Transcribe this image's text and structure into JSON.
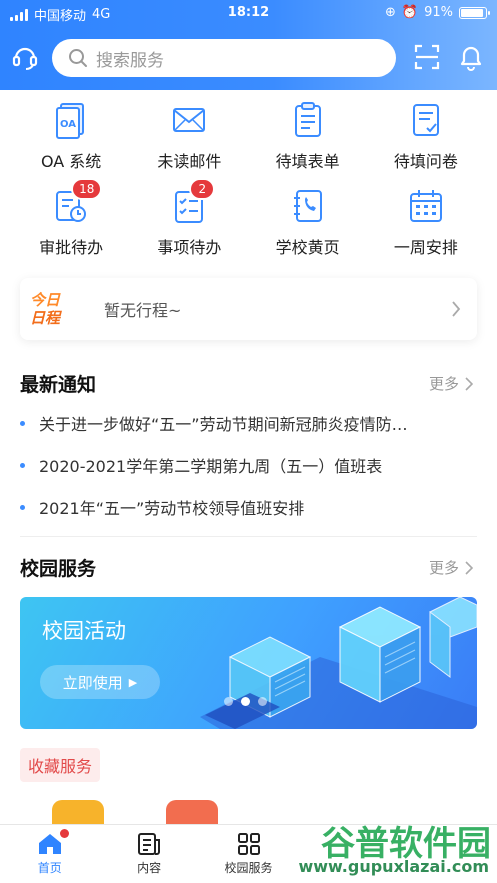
{
  "status_bar": {
    "carrier": "中国移动",
    "network": "4G",
    "time": "18:12",
    "battery": "91%",
    "battery_level": 0.91
  },
  "header": {
    "search_placeholder": "搜索服务"
  },
  "grid": {
    "row1": [
      {
        "label": "OA 系统",
        "icon": "oa-icon"
      },
      {
        "label": "未读邮件",
        "icon": "mail-icon"
      },
      {
        "label": "待填表单",
        "icon": "form-icon"
      },
      {
        "label": "待填问卷",
        "icon": "survey-icon"
      }
    ],
    "row2": [
      {
        "label": "审批待办",
        "icon": "approval-icon",
        "badge": "18"
      },
      {
        "label": "事项待办",
        "icon": "todo-icon",
        "badge": "2"
      },
      {
        "label": "学校黄页",
        "icon": "phone-book-icon"
      },
      {
        "label": "一周安排",
        "icon": "calendar-icon"
      }
    ]
  },
  "schedule": {
    "tag_line1": "今日",
    "tag_line2": "日程",
    "text": "暂无行程~"
  },
  "news": {
    "title": "最新通知",
    "more": "更多",
    "items": [
      "关于进一步做好“五一”劳动节期间新冠肺炎疫情防…",
      "2020-2021学年第二学期第九周（五一）值班表",
      "2021年“五一”劳动节校领导值班安排"
    ]
  },
  "campus": {
    "title": "校园服务",
    "more": "更多",
    "banner_title": "校园活动",
    "banner_button": "立即使用"
  },
  "favorites": {
    "label": "收藏服务"
  },
  "tabs": [
    {
      "label": "首页",
      "icon": "home-icon"
    },
    {
      "label": "内容",
      "icon": "content-icon"
    },
    {
      "label": "校园服务",
      "icon": "grid-icon"
    }
  ],
  "watermark": {
    "brand": "谷普软件园",
    "url": "www.gupuxlazai.com"
  },
  "colors": {
    "primary": "#2f84ff",
    "badge": "#e5393c",
    "schedule_tag": "#ff8a2a"
  }
}
